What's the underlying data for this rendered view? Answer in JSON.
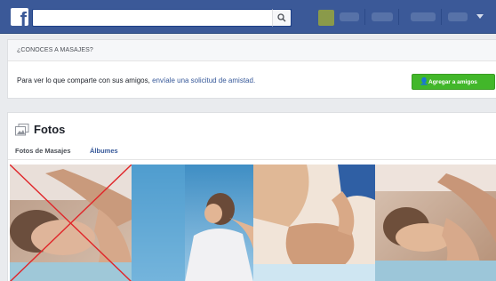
{
  "topbar": {
    "logo": "f",
    "search_placeholder": "",
    "icons": {
      "logo": "facebook-logo-icon",
      "search": "search-icon",
      "caret": "caret-down-icon"
    },
    "colors": {
      "bar": "#3b5998",
      "accent": "#42b72a",
      "link": "#365899"
    }
  },
  "friend_request": {
    "heading": "¿CONOCES A MASAJES?",
    "message": "Para ver lo que comparte con sus amigos,",
    "link": "envíale una solicitud de amistad.",
    "button_label": "Agregar a amigos",
    "button_icon": "add-friend-icon"
  },
  "photos": {
    "title": "Fotos",
    "title_icon": "photos-icon",
    "tabs": [
      {
        "label": "Fotos de Masajes"
      },
      {
        "label": "Álbumes"
      }
    ],
    "items": [
      {
        "description": "massage-photo-1",
        "crossed_out": true
      },
      {
        "description": "massage-photo-2",
        "crossed_out": false
      },
      {
        "description": "massage-photo-3",
        "crossed_out": false
      },
      {
        "description": "massage-photo-4",
        "crossed_out": false
      }
    ]
  }
}
